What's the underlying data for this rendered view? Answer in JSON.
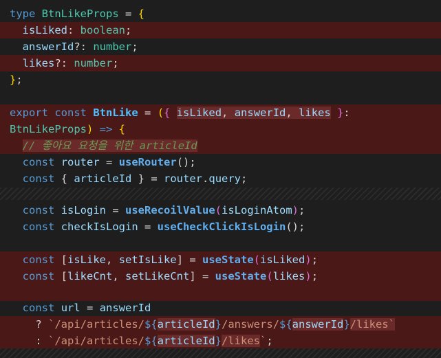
{
  "colors": {
    "background": "#1e1e1e",
    "removed_line": "#4b1818",
    "removed_word": "#6a2a2a",
    "keyword": "#569cd6",
    "type": "#4ec9b0",
    "variable": "#9cdcfe",
    "function": "#dcdcaa",
    "string": "#ce9178",
    "comment": "#6a9955"
  },
  "lines": [
    {
      "tokens": [
        {
          "t": "type",
          "c": "kw"
        },
        {
          "t": " ",
          "c": "pl"
        },
        {
          "t": "BtnLikeProps",
          "c": "type"
        },
        {
          "t": " = ",
          "c": "pl"
        },
        {
          "t": "{",
          "c": "br"
        }
      ]
    },
    {
      "removed": true,
      "tokens": [
        {
          "t": "  ",
          "c": "pl"
        },
        {
          "t": "isLiked",
          "c": "var"
        },
        {
          "t": ": ",
          "c": "pl"
        },
        {
          "t": "boolean",
          "c": "type"
        },
        {
          "t": ";",
          "c": "pl"
        }
      ]
    },
    {
      "tokens": [
        {
          "t": "  ",
          "c": "pl"
        },
        {
          "t": "answerId",
          "c": "var"
        },
        {
          "t": "?: ",
          "c": "pl"
        },
        {
          "t": "number",
          "c": "type"
        },
        {
          "t": ";",
          "c": "pl"
        }
      ]
    },
    {
      "removed": true,
      "tokens": [
        {
          "t": "  ",
          "c": "pl"
        },
        {
          "t": "likes",
          "c": "var"
        },
        {
          "t": "?: ",
          "c": "pl"
        },
        {
          "t": "number",
          "c": "type"
        },
        {
          "t": ";",
          "c": "pl"
        }
      ]
    },
    {
      "tokens": [
        {
          "t": "}",
          "c": "br"
        },
        {
          "t": ";",
          "c": "pl"
        }
      ]
    },
    {
      "empty": true,
      "tokens": []
    },
    {
      "removed": true,
      "tokens": [
        {
          "t": "export",
          "c": "kw"
        },
        {
          "t": " ",
          "c": "pl"
        },
        {
          "t": "const",
          "c": "kw"
        },
        {
          "t": " ",
          "c": "pl"
        },
        {
          "t": "BtnLike",
          "c": "typeb"
        },
        {
          "t": " = ",
          "c": "pl"
        },
        {
          "t": "(",
          "c": "br"
        },
        {
          "t": "{ ",
          "c": "br2"
        },
        {
          "t": "isLiked",
          "c": "var",
          "hl": true
        },
        {
          "t": ", ",
          "c": "pl",
          "hl": true
        },
        {
          "t": "answerId",
          "c": "var",
          "hl": true
        },
        {
          "t": ", ",
          "c": "pl",
          "hl": true
        },
        {
          "t": "likes",
          "c": "var",
          "hl": true
        },
        {
          "t": " ",
          "c": "pl"
        },
        {
          "t": "}",
          "c": "br2"
        },
        {
          "t": ":",
          "c": "pl"
        }
      ]
    },
    {
      "removed": true,
      "tokens": [
        {
          "t": "BtnLikeProps",
          "c": "type"
        },
        {
          "t": ")",
          "c": "br"
        },
        {
          "t": " => ",
          "c": "kw"
        },
        {
          "t": "{",
          "c": "br"
        }
      ]
    },
    {
      "removed": true,
      "tokens": [
        {
          "t": "  ",
          "c": "pl"
        },
        {
          "t": "// 좋아요 요청을 위한 articleId",
          "c": "cm",
          "hl": true
        }
      ]
    },
    {
      "tokens": [
        {
          "t": "  ",
          "c": "pl"
        },
        {
          "t": "const",
          "c": "kw"
        },
        {
          "t": " ",
          "c": "pl"
        },
        {
          "t": "router",
          "c": "var"
        },
        {
          "t": " = ",
          "c": "pl"
        },
        {
          "t": "useRouter",
          "c": "fnb"
        },
        {
          "t": "();",
          "c": "pl"
        }
      ]
    },
    {
      "tokens": [
        {
          "t": "  ",
          "c": "pl"
        },
        {
          "t": "const",
          "c": "kw"
        },
        {
          "t": " { ",
          "c": "pl"
        },
        {
          "t": "articleId",
          "c": "var"
        },
        {
          "t": " } = ",
          "c": "pl"
        },
        {
          "t": "router",
          "c": "var"
        },
        {
          "t": ".",
          "c": "pl"
        },
        {
          "t": "query",
          "c": "var"
        },
        {
          "t": ";",
          "c": "pl"
        }
      ]
    },
    {
      "hatch": true,
      "tokens": []
    },
    {
      "tokens": [
        {
          "t": "  ",
          "c": "pl"
        },
        {
          "t": "const",
          "c": "kw"
        },
        {
          "t": " ",
          "c": "pl"
        },
        {
          "t": "isLogin",
          "c": "var"
        },
        {
          "t": " = ",
          "c": "pl"
        },
        {
          "t": "useRecoilValue",
          "c": "fnb"
        },
        {
          "t": "(",
          "c": "br2"
        },
        {
          "t": "isLoginAtom",
          "c": "var"
        },
        {
          "t": ")",
          "c": "br2"
        },
        {
          "t": ";",
          "c": "pl"
        }
      ]
    },
    {
      "tokens": [
        {
          "t": "  ",
          "c": "pl"
        },
        {
          "t": "const",
          "c": "kw"
        },
        {
          "t": " ",
          "c": "pl"
        },
        {
          "t": "checkIsLogin",
          "c": "var"
        },
        {
          "t": " = ",
          "c": "pl"
        },
        {
          "t": "useCheckClickIsLogin",
          "c": "fnb"
        },
        {
          "t": "();",
          "c": "pl"
        }
      ]
    },
    {
      "empty": true,
      "tokens": []
    },
    {
      "removed": true,
      "tokens": [
        {
          "t": "  ",
          "c": "pl"
        },
        {
          "t": "const",
          "c": "kw"
        },
        {
          "t": " [",
          "c": "pl"
        },
        {
          "t": "isLike",
          "c": "var"
        },
        {
          "t": ", ",
          "c": "pl"
        },
        {
          "t": "setIsLike",
          "c": "var"
        },
        {
          "t": "] = ",
          "c": "pl"
        },
        {
          "t": "useState",
          "c": "fnb"
        },
        {
          "t": "(",
          "c": "br2"
        },
        {
          "t": "isLiked",
          "c": "var"
        },
        {
          "t": ")",
          "c": "br2"
        },
        {
          "t": ";",
          "c": "pl"
        }
      ]
    },
    {
      "removed": true,
      "tokens": [
        {
          "t": "  ",
          "c": "pl"
        },
        {
          "t": "const",
          "c": "kw"
        },
        {
          "t": " [",
          "c": "pl"
        },
        {
          "t": "likeCnt",
          "c": "var"
        },
        {
          "t": ", ",
          "c": "pl"
        },
        {
          "t": "setLikeCnt",
          "c": "var"
        },
        {
          "t": "] = ",
          "c": "pl"
        },
        {
          "t": "useState",
          "c": "fnb"
        },
        {
          "t": "(",
          "c": "br2"
        },
        {
          "t": "likes",
          "c": "var"
        },
        {
          "t": ")",
          "c": "br2"
        },
        {
          "t": ";",
          "c": "pl"
        }
      ]
    },
    {
      "removed": true,
      "empty": true,
      "tokens": []
    },
    {
      "tokens": [
        {
          "t": "  ",
          "c": "pl"
        },
        {
          "t": "const",
          "c": "kw"
        },
        {
          "t": " ",
          "c": "pl"
        },
        {
          "t": "url",
          "c": "var"
        },
        {
          "t": " = ",
          "c": "pl"
        },
        {
          "t": "answerId",
          "c": "var"
        }
      ]
    },
    {
      "removed": true,
      "tokens": [
        {
          "t": "    ? ",
          "c": "pl"
        },
        {
          "t": "`/api/articles/",
          "c": "str"
        },
        {
          "t": "${",
          "c": "kw"
        },
        {
          "t": "articleId",
          "c": "var",
          "hl": true
        },
        {
          "t": "}",
          "c": "kw"
        },
        {
          "t": "/answers/",
          "c": "str"
        },
        {
          "t": "${",
          "c": "kw"
        },
        {
          "t": "answerId",
          "c": "var",
          "hl": true
        },
        {
          "t": "}",
          "c": "kw"
        },
        {
          "t": "/likes`",
          "c": "str",
          "hl": true
        }
      ]
    },
    {
      "removed": true,
      "tokens": [
        {
          "t": "    : ",
          "c": "pl"
        },
        {
          "t": "`/api/articles/",
          "c": "str"
        },
        {
          "t": "${",
          "c": "kw"
        },
        {
          "t": "articleId",
          "c": "var",
          "hl": true
        },
        {
          "t": "}",
          "c": "kw"
        },
        {
          "t": "/likes",
          "c": "str",
          "hl": true
        },
        {
          "t": "`",
          "c": "str"
        },
        {
          "t": ";",
          "c": "pl"
        }
      ]
    },
    {
      "hatch": true,
      "tokens": []
    }
  ]
}
